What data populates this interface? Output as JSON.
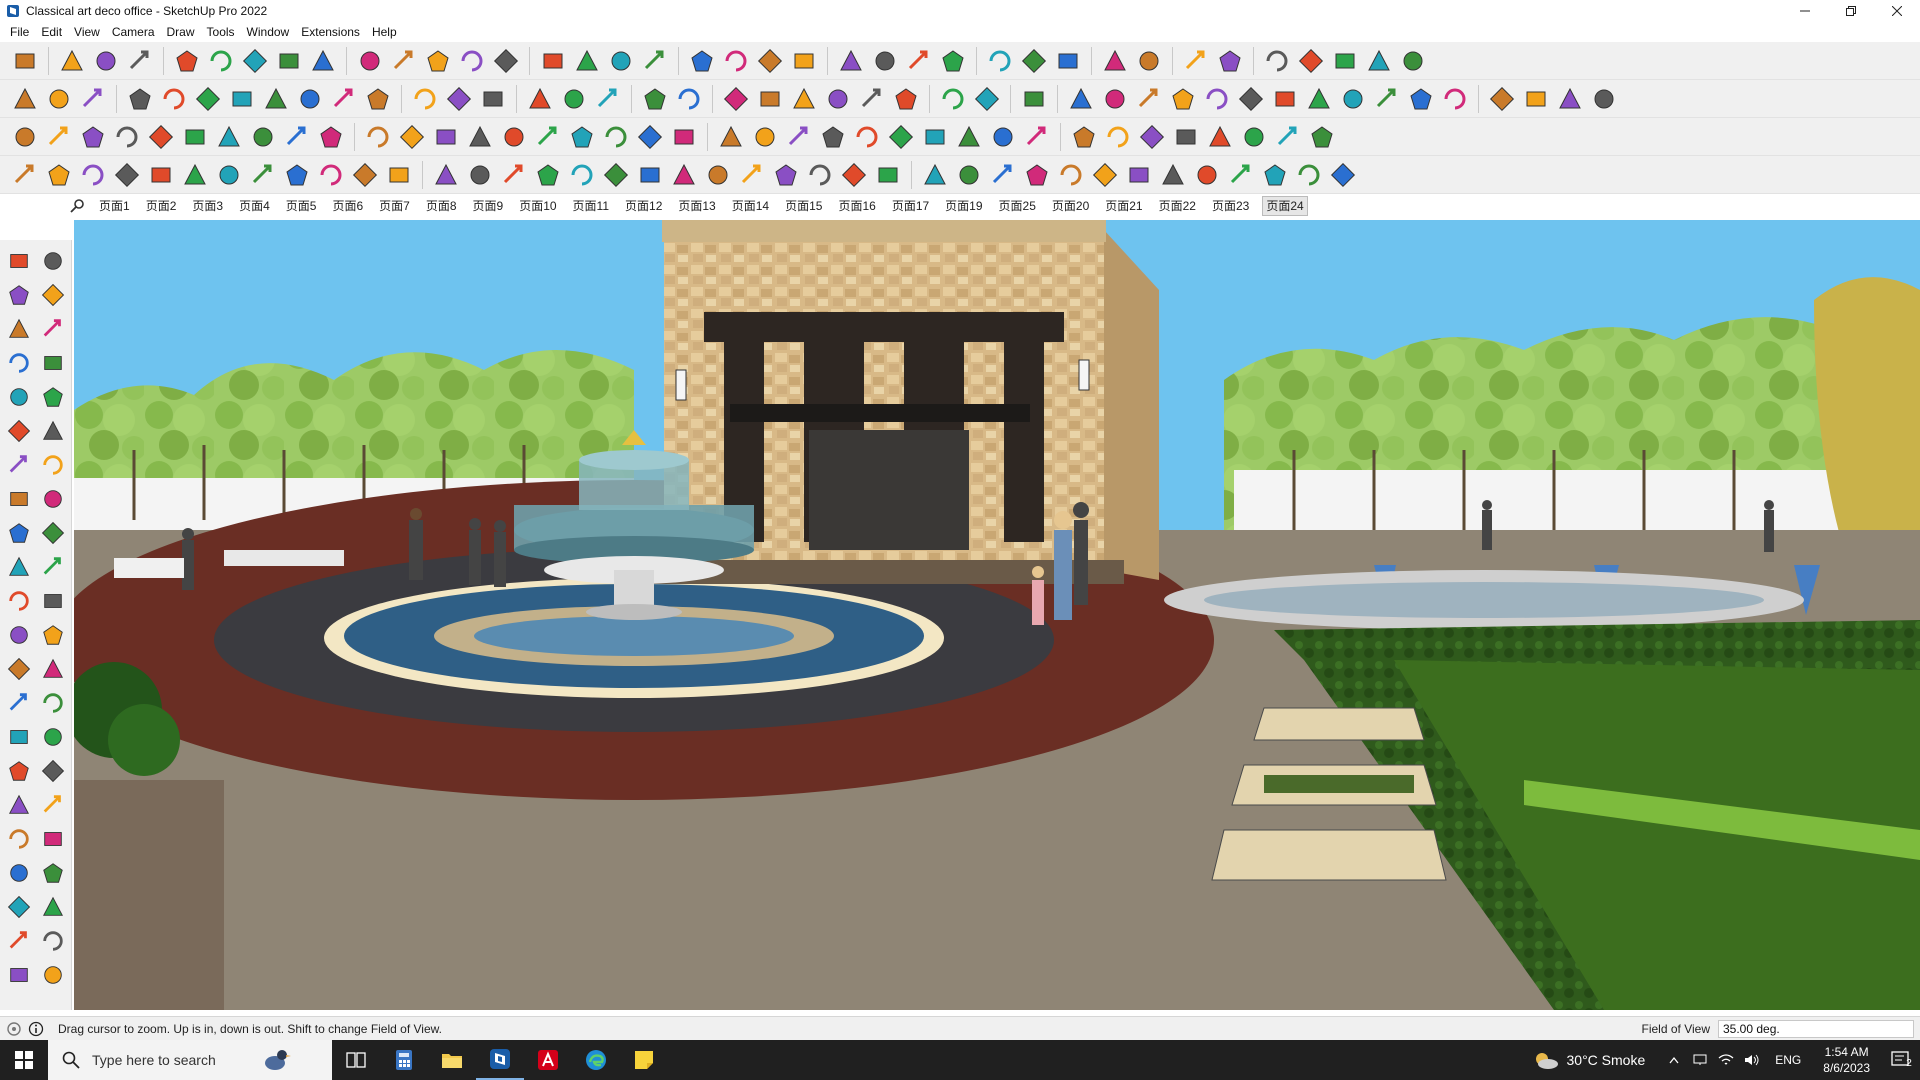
{
  "window": {
    "title": "Classical art deco office - SketchUp Pro 2022",
    "controls": [
      "minimize-icon",
      "restore-icon",
      "close-icon"
    ]
  },
  "menu": {
    "items": [
      "File",
      "Edit",
      "View",
      "Camera",
      "Draw",
      "Tools",
      "Window",
      "Extensions",
      "Help"
    ]
  },
  "scenes": {
    "tabs": [
      "页面1",
      "页面2",
      "页面3",
      "页面4",
      "页面5",
      "页面6",
      "页面7",
      "页面8",
      "页面9",
      "页面10",
      "页面11",
      "页面12",
      "页面13",
      "页面14",
      "页面15",
      "页面16",
      "页面17",
      "页面19",
      "页面25",
      "页面20",
      "页面21",
      "页面22",
      "页面23",
      "页面24"
    ],
    "active": "页面24"
  },
  "status": {
    "message": "Drag cursor to zoom.  Up is in, down is out. Shift to change Field of View.",
    "measure_label": "Field of View",
    "measure_value": "35.00 deg."
  },
  "taskbar": {
    "search_placeholder": "Type here to search",
    "weather": "30°C  Smoke",
    "language": "ENG",
    "time": "1:54 AM",
    "date": "8/6/2023",
    "notification_count": "2"
  },
  "colors": {
    "sky": "#6ec3ef",
    "trees": "#8bbd52",
    "plaza_red": "#6a2e24",
    "stone": "#d9b98a",
    "grass": "#3c6e1e",
    "toolbar_bg": "#f0f0f0",
    "taskbar_bg": "#202020"
  }
}
